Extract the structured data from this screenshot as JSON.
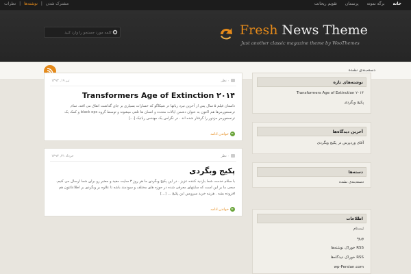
{
  "topbar": {
    "left_items": [
      "مشترک شدن",
      "|",
      "نوشته‌ها",
      "|",
      "نظرات"
    ],
    "right_items": [
      "خانه",
      "برگه نمونه",
      "پرسمان",
      "تقویم ریحانت"
    ]
  },
  "header": {
    "search_placeholder": "کلمه مورد جستجو را وارد کنید",
    "logo_fresh": "Fresh",
    "logo_rest": " News Theme",
    "tagline": "Just another classic magazine theme by WooThemes"
  },
  "subnav": {
    "category": "دسته‌بندی نشده"
  },
  "posts": [
    {
      "date": "تیر ۱۹, ۱۳۹۳",
      "comments": "۰ نظر",
      "title": "Transformers Age of Extinction ۲۰۱۴",
      "body": "داستان فیلم ۵ سال پس از آخرین نبرد رباتها در شیکاگو که خسارات بسیاری بر جای گذاشت اتفاق می افتد. تمام ترنسفورمرها هم اکنون به عنوان دشمن ایالات متحده و انسان ها تلقی میشوند و توسط گروه black ops و کمک یک ترنسفورمر مزدور را گرفتار شده اند . در نگراس یک مهندس رباتیک [...]",
      "more": "خواندن ادامه"
    },
    {
      "date": "خرداد ۳۱, ۱۳۹۳",
      "comments": "۰ نظر",
      "title": "پکیج وبگردی",
      "body": "با سلام خدمت شما بازدید کننده عزیز . در این پکیج وبگردی ما هر روز ۳ سایت مفید و معتبر رو برای شما ارسال می کنیم. سعی ما بر این است که سایتهای معرفی شده در حوزه های مختلف و سودمند باشه تا علاوه بر وبگردی بر اطلاعاتتون هم افزوده بشه . هزینه خرید سرویس این پکیج ... [...]",
      "more": "خواندن ادامه"
    }
  ],
  "sidebar": {
    "recent_posts": {
      "title": "نوشته‌های تازه",
      "items": [
        "Transformers Age of Extinction ۲۰۱۴",
        "پکیج وبگردی"
      ]
    },
    "recent_comments": {
      "title": "آخرین دیدگاه‌ها",
      "items": [
        "آقای وردپرس در پکیج وبگردی"
      ]
    },
    "categories": {
      "title": "دسته‌ها",
      "items": [
        "دسته‌بندی نشده"
      ]
    },
    "meta": {
      "title": "اطلاعات",
      "items": [
        "ثبت‌نام",
        "ورود",
        "RSS خوراک نوشته‌ها",
        "RSS خوراک دیدگاه‌ها",
        "wp-Persian.com"
      ]
    }
  },
  "colors": {
    "accent": "#e58a1a",
    "dark": "#2a2a2a",
    "background": "#e8e5de"
  }
}
